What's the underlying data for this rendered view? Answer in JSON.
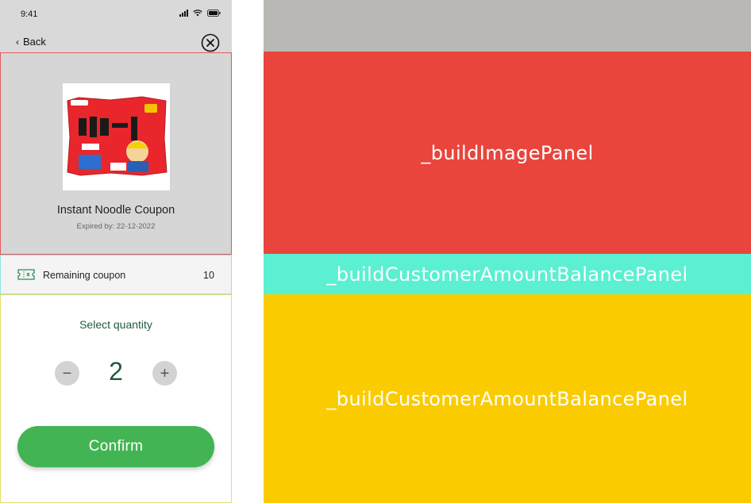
{
  "status_bar": {
    "time": "9:41",
    "icons": [
      "signal-icon",
      "wifi-icon",
      "battery-icon"
    ]
  },
  "nav": {
    "back_label": "Back",
    "close_icon": "close-circle-icon"
  },
  "image_panel": {
    "title": "Instant Noodle Coupon",
    "expiry": "Expired by: 22-12-2022",
    "background": "#d6d6d6"
  },
  "balance_panel": {
    "icon": "ticket-icon",
    "label": "Remaining coupon",
    "value": "10"
  },
  "quantity_panel": {
    "title": "Select quantity",
    "minus_label": "−",
    "plus_label": "+",
    "quantity": "2",
    "confirm_label": "Confirm"
  },
  "diagram": {
    "blocks": [
      {
        "label": "_buildImagePanel",
        "color": "#e9453c"
      },
      {
        "label": "_buildCustomerAmountBalancePanel",
        "color": "#5bf0d1"
      },
      {
        "label": "_buildCustomerAmountBalancePanel",
        "color": "#facc00"
      }
    ],
    "top_color": "#b9b8b4"
  },
  "colors": {
    "accent_green": "#43b453",
    "text_green": "#1f5b3c"
  }
}
